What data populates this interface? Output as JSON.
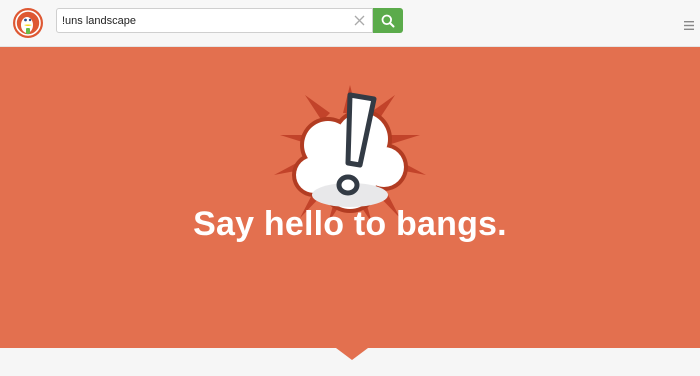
{
  "header": {
    "logo": "duckduckgo-logo",
    "search": {
      "value": "!uns landscape",
      "placeholder": ""
    },
    "icons": {
      "clear": "close-icon",
      "search": "search-icon",
      "menu": "hamburger-menu-icon"
    }
  },
  "hero": {
    "headline": "Say hello to bangs.",
    "illustration": "exclamation-cloud-icon"
  },
  "colors": {
    "hero_bg": "#e3704f",
    "search_button": "#5bab4b",
    "logo": "#de5833"
  }
}
